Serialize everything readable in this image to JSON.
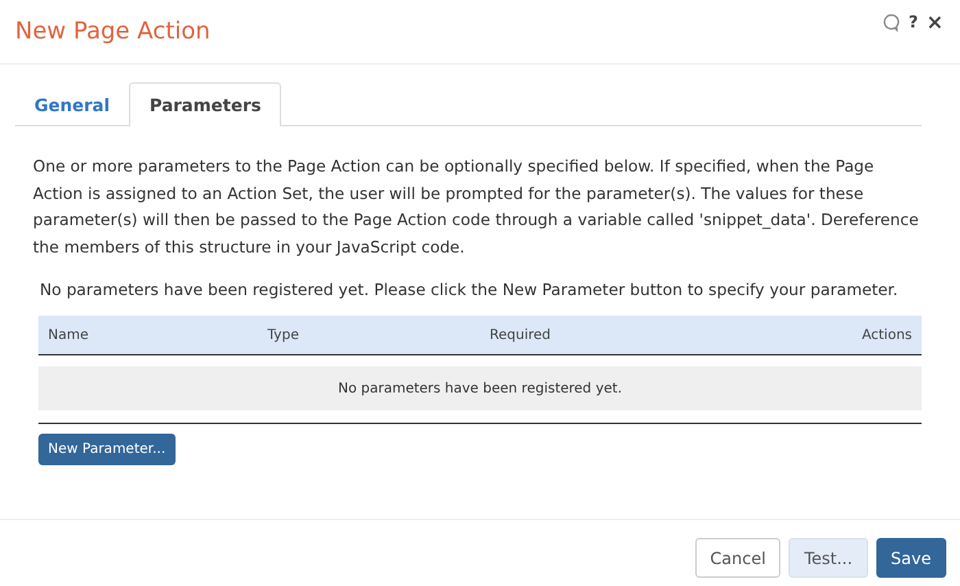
{
  "window": {
    "title": "New Page Action",
    "help": "?",
    "close": "×"
  },
  "tabs": [
    {
      "label": "General",
      "selected": false
    },
    {
      "label": "Parameters",
      "selected": true
    }
  ],
  "description": "One or more parameters to the Page Action can be optionally specified below. If specified, when the Page Action is assigned to an Action Set, the user will be prompted for the parameter(s). The values for these parameter(s) will then be passed to the Page Action code through a variable called 'snippet_data'. Dereference the members of this structure in your JavaScript code.",
  "notice": "No parameters have been registered yet. Please click the New Parameter button to specify your parameter.",
  "table": {
    "columns": [
      "Name",
      "Type",
      "Required",
      "Actions"
    ],
    "empty_message": "No parameters have been registered yet."
  },
  "add_button": "New Parameter...",
  "buttons": [
    {
      "label": "Cancel",
      "kind": "default"
    },
    {
      "label": "Test...",
      "kind": "secondary"
    },
    {
      "label": "Save",
      "kind": "primary"
    }
  ]
}
